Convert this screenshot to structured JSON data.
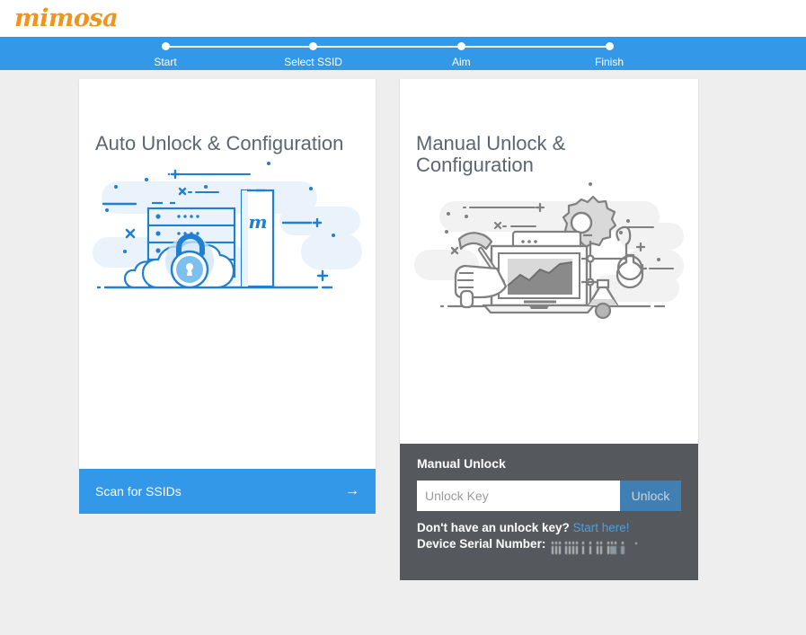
{
  "brand": {
    "logo_text": "mimosa",
    "logo_color": "#f0941e"
  },
  "theme": {
    "accent_blue": "#3498e8",
    "button_blue": "#3f7fb3",
    "link_blue": "#4a9fe0",
    "panel_dark": "#55595e",
    "page_bg": "#eeeeee",
    "title_gray": "#5b6670"
  },
  "steps": {
    "items": [
      {
        "label": "Start"
      },
      {
        "label": "Select SSID"
      },
      {
        "label": "Aim"
      },
      {
        "label": "Finish"
      }
    ]
  },
  "auto_card": {
    "title": "Auto Unlock & Configuration",
    "illustration": "server-cloud-padlock-illustration",
    "button_label": "Scan for SSIDs",
    "button_arrow": "→"
  },
  "manual_card": {
    "title": "Manual Unlock & Configuration",
    "illustration": "hammer-laptop-gear-flask-illustration"
  },
  "manual_panel": {
    "title": "Manual Unlock",
    "input_value": "",
    "input_placeholder": "Unlock Key",
    "unlock_button": "Unlock",
    "help_text": "Don't have an unlock key?",
    "help_link": "Start here!",
    "serial_label": "Device Serial Number:",
    "serial_value_redacted": true
  }
}
